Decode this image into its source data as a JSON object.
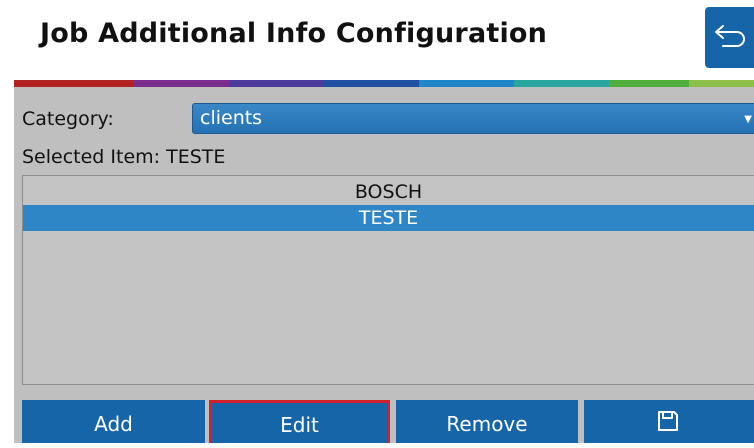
{
  "header": {
    "title": "Job Additional Info Configuration",
    "back_icon": "back-arrow-icon"
  },
  "stripe_colors": [
    "#b22222",
    "#7b2d8e",
    "#4b3a9b",
    "#1e4fa0",
    "#1f86c8",
    "#2aa6a0",
    "#4fae3c",
    "#8cc04a"
  ],
  "form": {
    "category_label": "Category:",
    "category_value": "clients",
    "selected_label": "Selected Item: TESTE"
  },
  "list": {
    "items": [
      {
        "label": "BOSCH",
        "selected": false
      },
      {
        "label": "TESTE",
        "selected": true
      }
    ]
  },
  "buttons": {
    "add": "Add",
    "edit": "Edit",
    "remove": "Remove",
    "save_icon": "save-icon"
  },
  "colors": {
    "accent": "#1565a8",
    "selection": "#2f86c6",
    "highlight_border": "#d0202e",
    "panel": "#bfbfbf"
  }
}
